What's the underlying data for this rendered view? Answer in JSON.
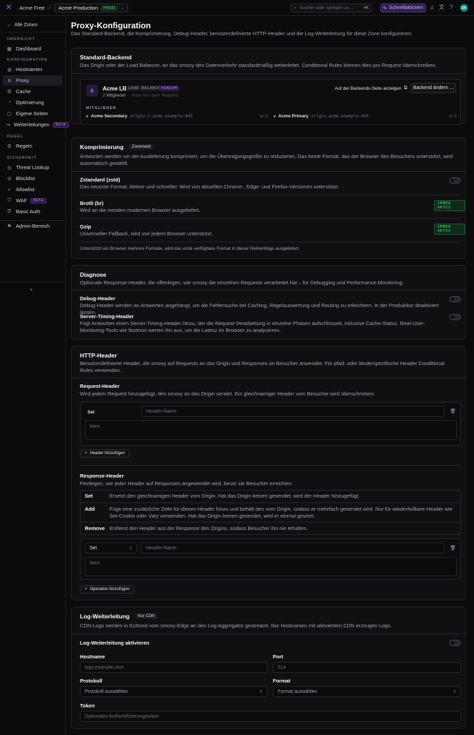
{
  "topbar": {
    "logo": "✕",
    "zone": "Acme Free",
    "sep": "/",
    "env_name": "Acme Production",
    "env_badge": "PROD",
    "search_placeholder": "Suchen oder springen zu...",
    "search_kbd": "⌘K",
    "quick_actions": "Schnellaktionen",
    "avatar": "DK"
  },
  "sidebar": {
    "back": "Alle Zonen",
    "sections": {
      "overview": "ÜBERSICHT",
      "config": "KONFIGURATION",
      "rules": "REGEL",
      "security": "SICHERHEIT"
    },
    "items": {
      "dashboard": "Dashboard",
      "hostnames": "Hostnamen",
      "proxy": "Proxy",
      "cache": "Cache",
      "optimization": "Optimierung",
      "pages": "Eigene Seiten",
      "redirects": "Weiterleitungen",
      "redirects_badge": "BETA",
      "rules": "Regeln",
      "threat": "Threat Lookup",
      "blocklist": "Blocklist",
      "allowlist": "Allowlist",
      "waf": "WAF",
      "waf_badge": "BETA",
      "basic_auth": "Basic Auth",
      "admin": "Admin-Bereich"
    }
  },
  "page": {
    "title": "Proxy-Konfiguration",
    "subtitle": "Das Standard-Backend, die Komprimierung, Debug-Header, benutzerdefinierte HTTP-Header und die Log-Weiterleitung für diese Zone konfigurieren."
  },
  "backend": {
    "title": "Standard-Backend",
    "desc": "Das Origin oder der Load Balancer, an das smoxy den Datenverkehr standardmäßig weiterleitet. Conditional Rules können dies pro Request überschreiben.",
    "name": "Acme LB",
    "type_chip": "LOAD BALANCER",
    "strategy_chip": "RANDOM",
    "members_count": "2 Mitglieder",
    "host_meta": "Host Aus dem Request",
    "view_link": "Auf der Backends-Seite anzeigen",
    "change_btn": "Backend ändern ...",
    "members_label": "MITGLIEDER",
    "members": [
      {
        "name": "Acme Secondary",
        "host": "origin-2.acme.example:443",
        "weight": "w:1"
      },
      {
        "name": "Acme Primary",
        "host": "origin.acme.example:443",
        "weight": "w:1"
      }
    ]
  },
  "compression": {
    "title": "Komprimierung",
    "chip": "Zonenweit",
    "desc": "Antworten werden vor der Auslieferung komprimiert, um die Übertragungsgröße zu reduzieren. Das beste Format, das der Browser des Besuchers unterstützt, wird automatisch gewählt.",
    "zstd_title": "Zstandard (zstd)",
    "zstd_desc": "Das neueste Format, kleiner und schneller. Wird von aktuellen Chrome-, Edge- und Firefox-Versionen unterstützt.",
    "brotli_title": "Brotli (br)",
    "brotli_desc": "Wird an die meisten modernen Browser ausgeliefert.",
    "gzip_title": "Gzip",
    "gzip_desc": "Universeller Fallback, wird von jedem Browser unterstützt.",
    "always": "IMMER AKTIV",
    "footer": "Unterstützt ein Browser mehrere Formate, wird das erste verfügbare Format in dieser Reihenfolge ausgeliefert."
  },
  "diagnostics": {
    "title": "Diagnose",
    "desc": "Optionale Response-Header, die offenlegen, wie smoxy die einzelnen Requests verarbeitet hat – für Debugging und Performance-Monitoring.",
    "debug_title": "Debug-Header",
    "debug_desc": "Debug-Header werden an Antworten angehängt, um die Fehlersuche bei Caching, Regelauswertung und Routing zu erleichtern. In der Produktion deaktiviert lassen.",
    "timing_title": "Server-Timing-Header",
    "timing_desc": "Fügt Antworten einen Server-Timing-Header hinzu, der die Request-Verarbeitung in einzelne Phasen aufschlüsselt, inklusive Cache-Status. Real-User-Monitoring-Tools wie fastmon werten ihn aus, um die Latenz im Browser zu analysieren."
  },
  "http_headers": {
    "title": "HTTP-Header",
    "desc": "Benutzerdefinierte Header, die smoxy auf Requests an das Origin und Responses an Besucher anwendet. Für pfad- oder länderspezifische Header Conditional Rules verwenden.",
    "req_title": "Request-Header",
    "req_desc": "Wird jedem Request hinzugefügt, den smoxy an das Origin sendet. Ein gleichnamiger Header vom Besucher wird überschrieben.",
    "req_op": "Set",
    "name_placeholder": "Header-Name",
    "value_placeholder": "Wert",
    "add_header": "Header hinzufügen",
    "resp_title": "Response-Header",
    "resp_desc": "Festlegen, wie jeder Header auf Responses angewendet wird, bevor sie Besucher erreichen:",
    "ops": [
      {
        "k": "Set",
        "v": "Ersetzt den gleichnamigen Header vom Origin. Hat das Origin keinen gesendet, wird der Header hinzugefügt."
      },
      {
        "k": "Add",
        "v": "Füge eine zusätzliche Zeile für diesen Header hinzu und behält den vom Origin, sodass er mehrfach gesendet wird. Nur für wiederholbare Header wie Set-Cookie oder Vary verwenden. Hat das Origin keinen gesendet, wird er einmal gesetzt."
      },
      {
        "k": "Remove",
        "v": "Entfernt den Header aus der Response des Origins, sodass Besucher ihn nie erhalten."
      }
    ],
    "resp_op": "Set",
    "add_op": "Operation hinzufügen"
  },
  "logfwd": {
    "title": "Log-Weiterleitung",
    "chip": "Nur CDN",
    "desc": "CDN-Logs werden in Echtzeit vom smoxy-Edge an den Log-Aggregator gestreamt. Nur Hostnamen mit aktiviertem CDN erzeugen Logs.",
    "enable": "Log-Weiterleitung aktivieren",
    "hostname_label": "Hostname",
    "hostname_ph": "logs.example.com",
    "port_label": "Port",
    "port_ph": "514",
    "protocol_label": "Protokoll",
    "protocol_ph": "Protokoll auswählen",
    "format_label": "Format",
    "format_ph": "Format auswählen",
    "token_label": "Token",
    "token_ph": "Optionales Authentifizierungstoken"
  }
}
